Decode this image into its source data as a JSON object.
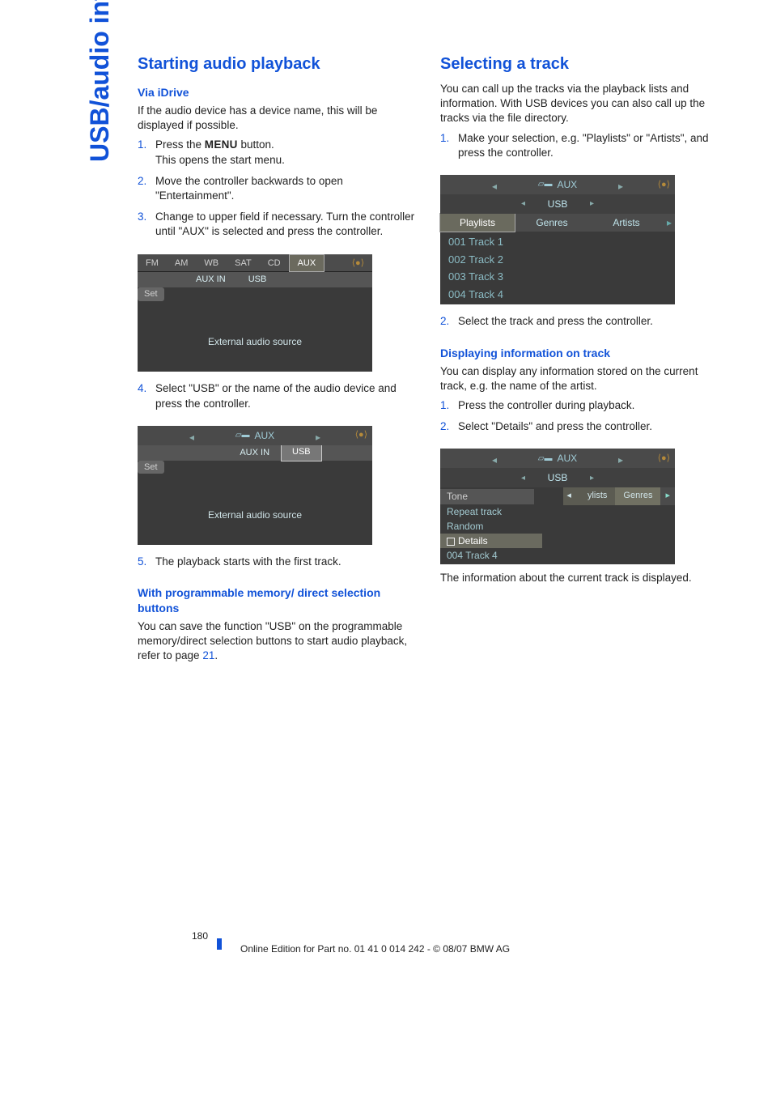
{
  "side_tab": "USB/audio interface",
  "left": {
    "heading": "Starting audio playback",
    "sub1": "Via iDrive",
    "intro": "If the audio device has a device name, this will be displayed if possible.",
    "steps_a": [
      {
        "pre": "Press the ",
        "btn": "MENU",
        "post": " button.",
        "line2": "This opens the start menu."
      },
      {
        "text": "Move the controller backwards to open \"Entertainment\"."
      },
      {
        "text": "Change to upper field if necessary. Turn the controller until \"AUX\" is selected and press the controller."
      }
    ],
    "screen1": {
      "title": "AUX",
      "tabs": [
        "FM",
        "AM",
        "WB",
        "SAT",
        "CD",
        "AUX"
      ],
      "sel_tab": "AUX",
      "subtabs": [
        "AUX IN",
        "USB"
      ],
      "sel_sub": "",
      "set": "Set",
      "body": "External audio source"
    },
    "step4": "Select \"USB\" or the name of the audio device and press the controller.",
    "screen2": {
      "title": "AUX",
      "subtabs": [
        "AUX IN",
        "USB"
      ],
      "sel_sub": "USB",
      "set": "Set",
      "body": "External audio source"
    },
    "step5": "The playback starts with the first track.",
    "sub2": "With programmable memory/ direct selection buttons",
    "para2_a": "You can save the function \"USB\" on the programmable memory/direct selection buttons to start audio playback, refer to page ",
    "para2_page": "21",
    "para2_b": "."
  },
  "right": {
    "heading": "Selecting a track",
    "intro": "You can call up the tracks via the playback lists and information. With USB devices you can also call up the tracks via the file directory.",
    "step1": "Make your selection, e.g. \"Playlists\" or \"Artists\", and press the controller.",
    "screen3": {
      "title": "AUX",
      "sub": "USB",
      "cols": [
        "Playlists",
        "Genres",
        "Artists"
      ],
      "sel_col": "Playlists",
      "tracks": [
        "001 Track 1",
        "002 Track 2",
        "003 Track 3",
        "004 Track 4"
      ]
    },
    "step2": "Select the track and press the controller.",
    "sub1": "Displaying information on track",
    "para1": "You can display any information stored on the current track, e.g. the name of the artist.",
    "d_step1": "Press the controller during playback.",
    "d_step2": "Select \"Details\" and press the controller.",
    "screen4": {
      "title": "AUX",
      "sub": "USB",
      "right_tabs": [
        "ylists",
        "Genres"
      ],
      "items": [
        "Tone",
        "Repeat track",
        "Random",
        "Details",
        "004 Track 4"
      ],
      "sel_item": "Details",
      "hdr_item": "Tone"
    },
    "para2": "The information about the current track is displayed."
  },
  "footer": {
    "page": "180",
    "line": "Online Edition for Part no. 01 41 0 014 242 - © 08/07 BMW AG"
  }
}
